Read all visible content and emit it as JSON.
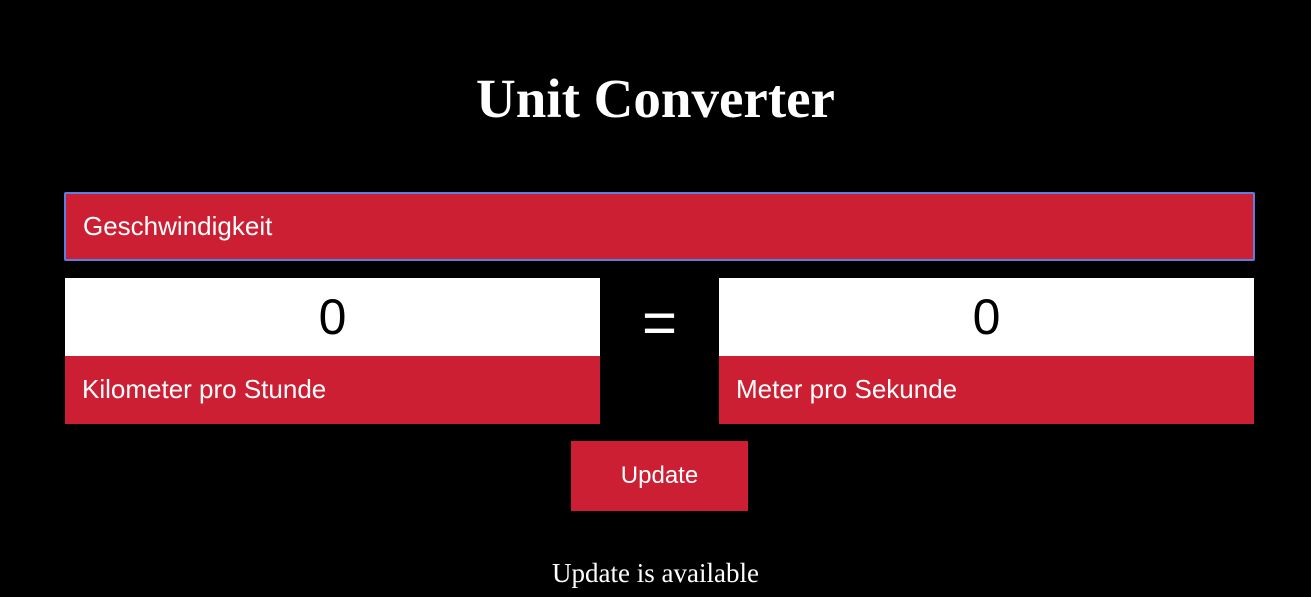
{
  "app": {
    "title": "Unit Converter"
  },
  "category": {
    "selected": "Geschwindigkeit"
  },
  "converter": {
    "from": {
      "value": "0",
      "unit": "Kilometer pro Stunde"
    },
    "equals_sign": "=",
    "to": {
      "value": "0",
      "unit": "Meter pro Sekunde"
    }
  },
  "actions": {
    "update_label": "Update"
  },
  "status": {
    "message": "Update is available"
  },
  "colors": {
    "background": "#000000",
    "accent": "#cc1f33",
    "focus_border": "#5b7ee0",
    "text": "#ffffff",
    "input_background": "#ffffff"
  }
}
